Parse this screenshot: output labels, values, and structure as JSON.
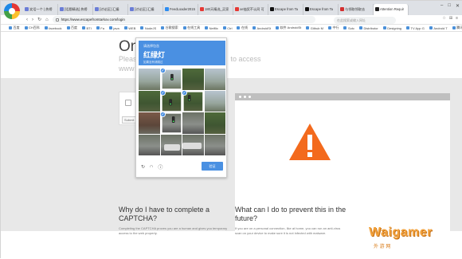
{
  "tabs": [
    {
      "label": "笑话一个 | 热榜",
      "cls": ""
    },
    {
      "label": "[话题精选] 热榜",
      "cls": ""
    },
    {
      "label": "[讨论区] 汇编",
      "cls": ""
    },
    {
      "label": "[讨论区] 汇编",
      "cls": ""
    },
    {
      "label": "FeedLoader2015",
      "cls": "t4"
    },
    {
      "label": "180天精选_买家",
      "cls": "t5"
    },
    {
      "label": "xe抽奖不认同 可",
      "cls": "t5"
    },
    {
      "label": "Escape from Ta",
      "cls": "t6"
    },
    {
      "label": "Escape from Ta",
      "cls": "t7"
    },
    {
      "label": "与领取领取去 ",
      "cls": "t8"
    },
    {
      "label": "Attention Requir",
      "cls": "t9"
    }
  ],
  "address": {
    "url": "https://www.escapefromtarkov.com/login",
    "search_placeholder": "在此搜索或输入网址"
  },
  "bookmarks": [
    "百度",
    "CH百科",
    "facebook",
    "百度",
    "BTI",
    "Fa",
    "java",
    "WEB",
    "NodeJS",
    "谷歌搜索",
    "在线工具",
    "Netflix",
    "Ctrl",
    "在线",
    "AndroidSt",
    "软件 AndroidSt",
    "Github M",
    "中行",
    "Sotc",
    "Distributor",
    "Designing",
    "TV App G",
    "Android T",
    "腾讯视频"
  ],
  "page": {
    "title": "On",
    "subtitle": "Please ... to access www.",
    "subtitle_right": "to access",
    "submit": "Submit"
  },
  "captcha": {
    "line1": "请选择包含",
    "line2": "红绿灯",
    "line3": "如果没有请跳过",
    "verify": "验证"
  },
  "qa": [
    {
      "title": "Why do I have to complete a CAPTCHA?",
      "body": "Completing the CAPTCHA proves you are a human and gives you temporary access to the web property."
    },
    {
      "title": "What can I do to prevent this in the future?",
      "body": "If you are on a personal connection, like at home, you can run an anti-virus scan on your device to make sure it is not infected with malware."
    }
  ],
  "watermark": {
    "text": "Waigamer",
    "sub": "外 游 网"
  },
  "colors": {
    "captcha_blue": "#4a90e2",
    "warning_orange": "#f36a1d"
  }
}
